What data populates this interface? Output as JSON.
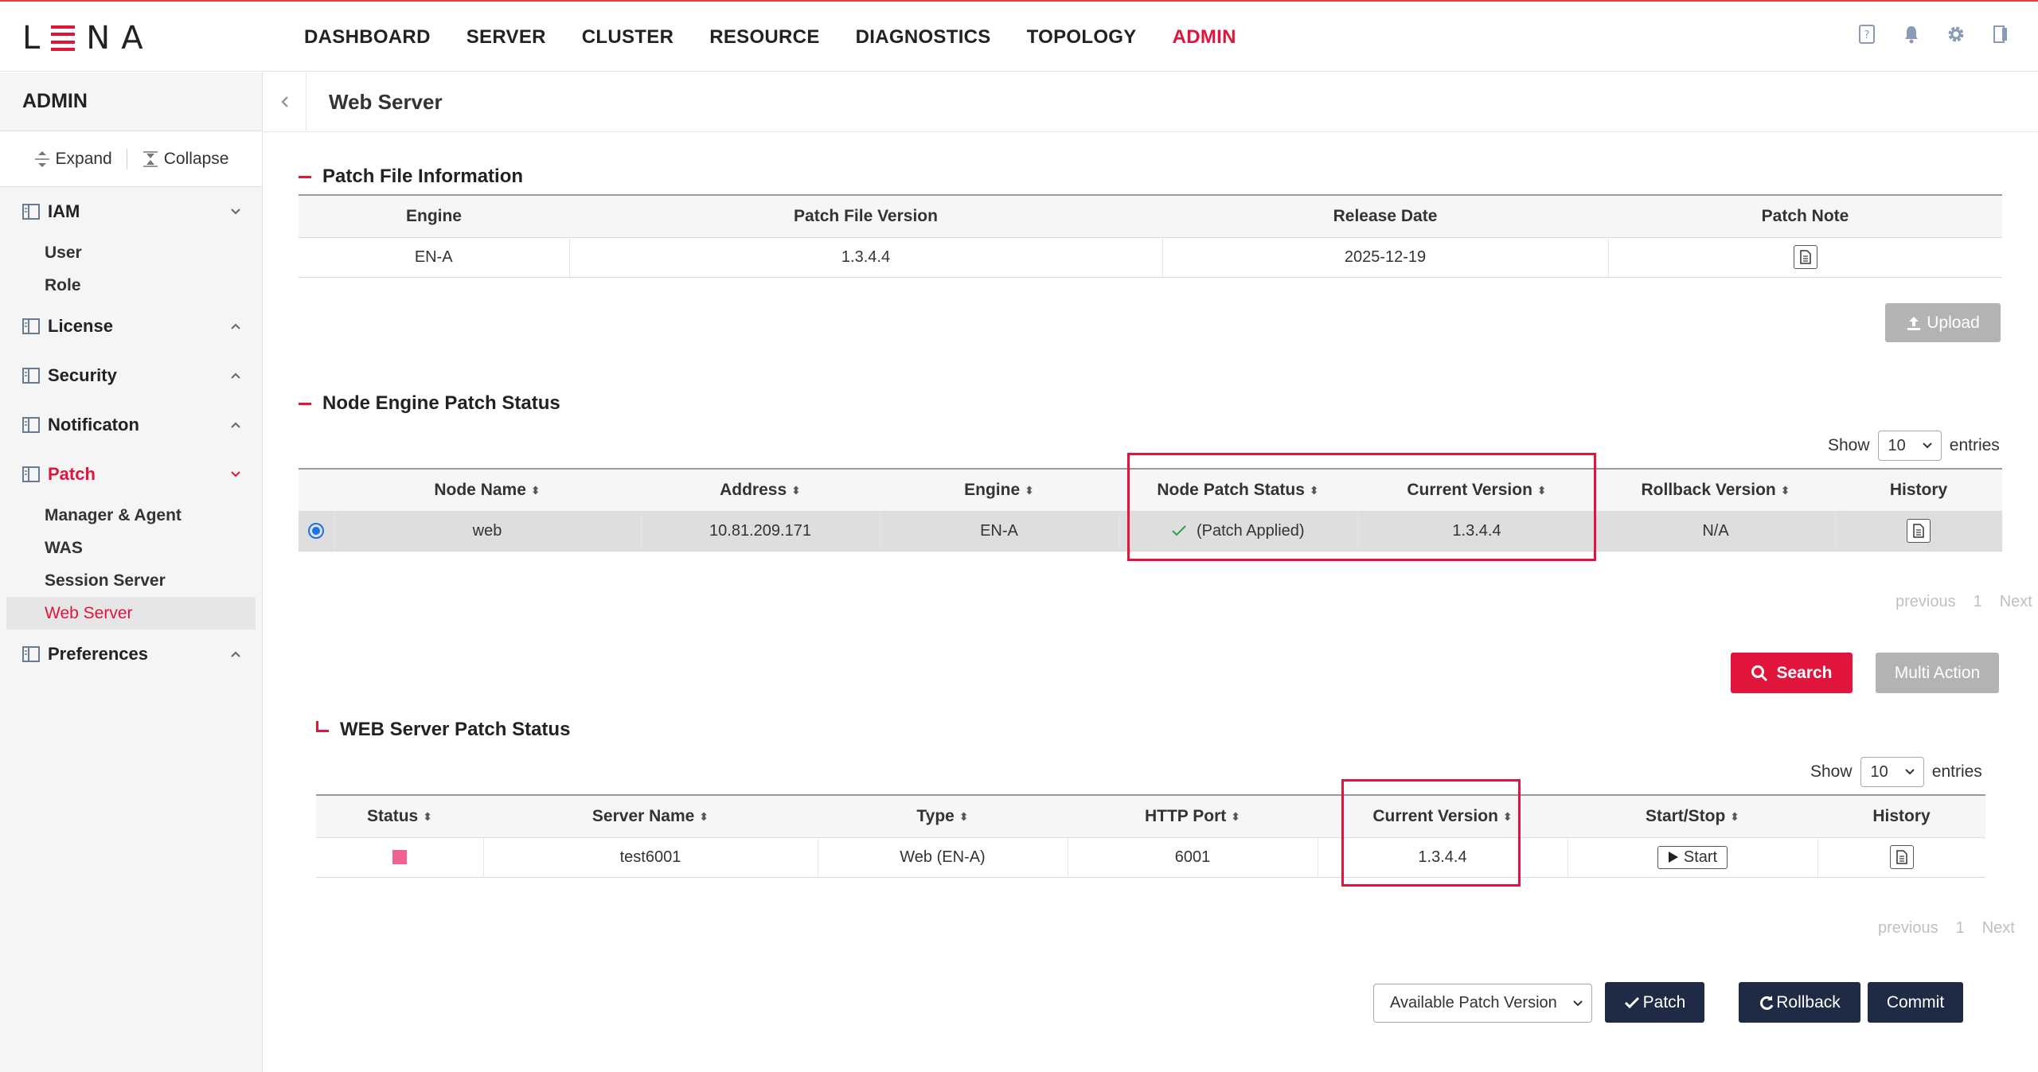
{
  "app": {
    "logo_text_pre": "L",
    "logo_text_post": "NA",
    "accent_color": "#e1143c"
  },
  "nav": {
    "items": [
      "DASHBOARD",
      "SERVER",
      "CLUSTER",
      "RESOURCE",
      "DIAGNOSTICS",
      "TOPOLOGY",
      "ADMIN"
    ],
    "active": "ADMIN"
  },
  "top_icons": [
    "help-icon",
    "bell-icon",
    "gear-icon",
    "logout-icon"
  ],
  "sidebar": {
    "title": "ADMIN",
    "expand_label": "Expand",
    "collapse_label": "Collapse",
    "groups": {
      "iam": {
        "label": "IAM",
        "items": [
          "User",
          "Role"
        ]
      },
      "license": {
        "label": "License"
      },
      "security": {
        "label": "Security"
      },
      "notification": {
        "label": "Notificaton"
      },
      "patch": {
        "label": "Patch",
        "items": [
          "Manager & Agent",
          "WAS",
          "Session Server",
          "Web Server"
        ],
        "active": "Web Server"
      },
      "preferences": {
        "label": "Preferences"
      }
    }
  },
  "page": {
    "title": "Web Server"
  },
  "patch_file": {
    "title": "Patch File Information",
    "headers": [
      "Engine",
      "Patch File Version",
      "Release Date",
      "Patch Note"
    ],
    "row": {
      "engine": "EN-A",
      "version": "1.3.4.4",
      "release_date": "2025-12-19"
    },
    "upload_label": "Upload"
  },
  "node_status": {
    "title": "Node Engine Patch Status",
    "show_label": "Show",
    "entries_label": "entries",
    "page_size": "10",
    "headers": [
      "Node Name",
      "Address",
      "Engine",
      "Node Patch Status",
      "Current Version",
      "Rollback Version",
      "History"
    ],
    "row": {
      "name": "web",
      "address": "10.81.209.171",
      "engine": "EN-A",
      "patch_status": "(Patch Applied)",
      "current_version": "1.3.4.4",
      "rollback_version": "N/A"
    },
    "pager": {
      "previous": "previous",
      "page": "1",
      "next": "Next"
    },
    "search_label": "Search",
    "multi_action_label": "Multi Action"
  },
  "web_status": {
    "title": "WEB Server Patch Status",
    "show_label": "Show",
    "entries_label": "entries",
    "page_size": "10",
    "headers": [
      "Status",
      "Server Name",
      "Type",
      "HTTP Port",
      "Current Version",
      "Start/Stop",
      "History"
    ],
    "row": {
      "status_color": "#f06292",
      "server_name": "test6001",
      "type": "Web (EN-A)",
      "http_port": "6001",
      "current_version": "1.3.4.4",
      "action": "Start"
    },
    "pager": {
      "previous": "previous",
      "page": "1",
      "next": "Next"
    }
  },
  "actions": {
    "patch_version_select": "Available Patch Version",
    "patch_label": "Patch",
    "rollback_label": "Rollback",
    "commit_label": "Commit"
  }
}
